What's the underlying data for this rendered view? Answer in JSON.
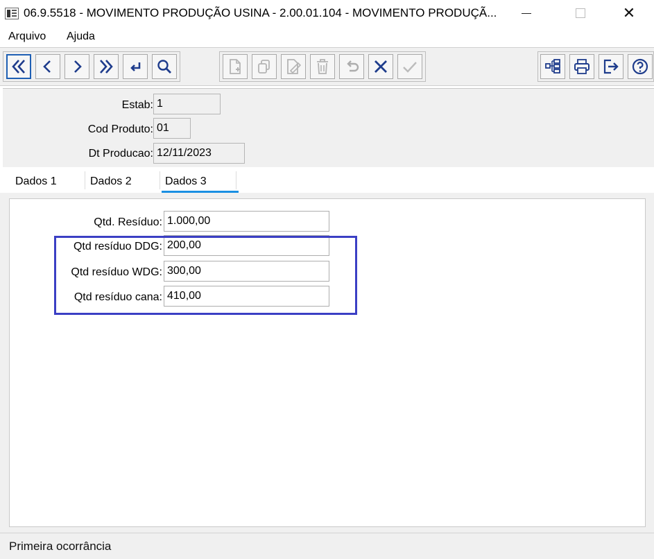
{
  "window": {
    "title": "06.9.5518 - MOVIMENTO PRODUÇÃO USINA - 2.00.01.104 - MOVIMENTO PRODUÇÃ...",
    "close_glyph": "✕"
  },
  "menu": {
    "items": [
      {
        "label": "Arquivo"
      },
      {
        "label": "Ajuda"
      }
    ]
  },
  "toolbar": {
    "icons": [
      "first-record-icon",
      "previous-record-icon",
      "next-record-icon",
      "last-record-icon",
      "goto-icon",
      "search-icon",
      "new-document-icon",
      "copy-icon",
      "edit-icon",
      "delete-icon",
      "undo-icon",
      "cancel-icon",
      "confirm-icon",
      "hierarchy-icon",
      "print-icon",
      "exit-icon",
      "help-icon"
    ],
    "accent_color": "#1e5fb4"
  },
  "header": {
    "fields": [
      {
        "label": "Estab:",
        "value": "1"
      },
      {
        "label": "Cod Produto:",
        "value": "01"
      },
      {
        "label": "Dt Producao:",
        "value": "12/11/2023"
      }
    ]
  },
  "tabs": [
    {
      "label": "Dados 1"
    },
    {
      "label": "Dados 2"
    },
    {
      "label": "Dados 3",
      "active": true
    }
  ],
  "tab_accent_color": "#1a8fe3",
  "form": {
    "fields": [
      {
        "label": "Qtd. Resíduo:",
        "value": "1.000,00"
      },
      {
        "label": "Qtd resíduo DDG:",
        "value": "200,00"
      },
      {
        "label": "Qtd resíduo WDG:",
        "value": "300,00"
      },
      {
        "label": "Qtd resíduo cana:",
        "value": "410,00"
      }
    ],
    "highlight_color": "#3b3fc4"
  },
  "status": {
    "text": "Primeira ocorrância"
  }
}
